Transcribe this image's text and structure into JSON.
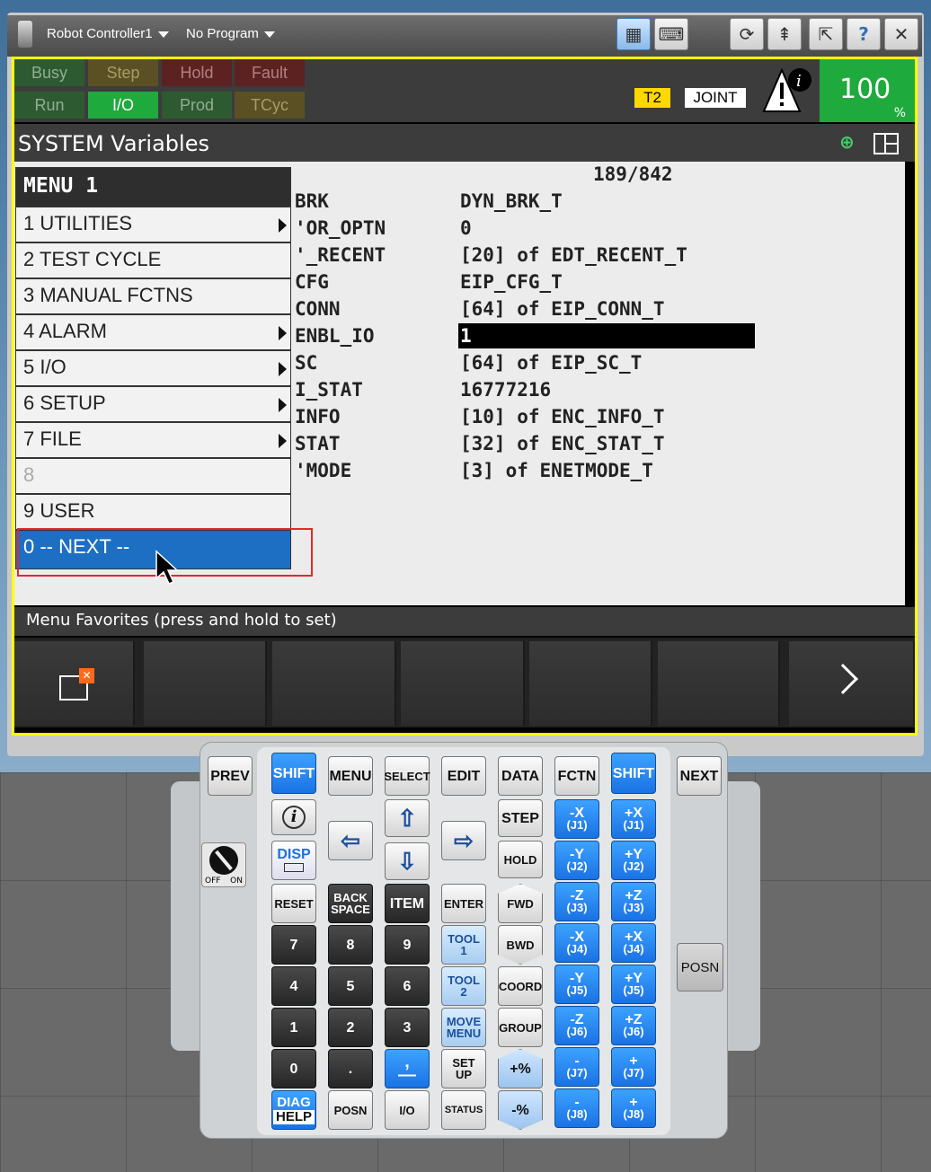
{
  "app": {
    "controller": "Robot Controller1",
    "program": "No Program"
  },
  "status_leds": {
    "row1": [
      "Busy",
      "Step",
      "Hold",
      "Fault"
    ],
    "row2": [
      "Run",
      "I/O",
      "Prod",
      "TCyc"
    ],
    "active": "I/O"
  },
  "indicators": {
    "mode": "T2",
    "coord": "JOINT",
    "override": "100",
    "override_unit": "%"
  },
  "screen": {
    "title": "SYSTEM Variables",
    "position": "189/842"
  },
  "variables": [
    {
      "name": "BRK",
      "value": "DYN_BRK_T"
    },
    {
      "name": "'OR_OPTN",
      "value": "0"
    },
    {
      "name": "'_RECENT",
      "value": "[20] of EDT_RECENT_T"
    },
    {
      "name": "CFG",
      "value": "EIP_CFG_T"
    },
    {
      "name": "CONN",
      "value": "[64] of EIP_CONN_T"
    },
    {
      "name": "ENBL_IO",
      "value": "1"
    },
    {
      "name": "SC",
      "value": "[64] of EIP_SC_T"
    },
    {
      "name": "I_STAT",
      "value": "16777216"
    },
    {
      "name": "INFO",
      "value": "[10] of ENC_INFO_T"
    },
    {
      "name": "STAT",
      "value": "[32] of ENC_STAT_T"
    },
    {
      "name": "'MODE",
      "value": "[3] of ENETMODE_T"
    }
  ],
  "menu": {
    "title": "MENU  1",
    "items": [
      {
        "label": "1 UTILITIES"
      },
      {
        "label": "2 TEST CYCLE"
      },
      {
        "label": "3 MANUAL FCTNS"
      },
      {
        "label": "4 ALARM"
      },
      {
        "label": "5 I/O"
      },
      {
        "label": "6 SETUP"
      },
      {
        "label": "7 FILE"
      },
      {
        "label": "8"
      },
      {
        "label": "9 USER"
      },
      {
        "label": "0 -- NEXT --"
      }
    ]
  },
  "favorites": {
    "label": "Menu Favorites (press and hold to set)"
  },
  "keypad": {
    "top": [
      "PREV",
      "SHIFT",
      "MENU",
      "SELECT",
      "EDIT",
      "DATA",
      "FCTN",
      "SHIFT",
      "NEXT"
    ],
    "disp": "DISP",
    "reset": "RESET",
    "backspace": [
      "BACK",
      "SPACE"
    ],
    "item": "ITEM",
    "enter": "ENTER",
    "step": "STEP",
    "hold": "HOLD",
    "fwd": "FWD",
    "bwd": "BWD",
    "coord": "COORD",
    "group": "GROUP",
    "digits": [
      "7",
      "8",
      "9",
      "4",
      "5",
      "6",
      "1",
      "2",
      "3",
      "0",
      "."
    ],
    "tool1": [
      "TOOL",
      "1"
    ],
    "tool2": [
      "TOOL",
      "2"
    ],
    "move_menu": [
      "MOVE",
      "MENU"
    ],
    "setup": [
      "SET",
      "UP"
    ],
    "plus_pct": "+%",
    "minus_pct": "-%",
    "diag": "DIAG",
    "help": "HELP",
    "posn": "POSN",
    "io": "I/O",
    "status": "STATUS",
    "side_posn": "POSN",
    "switch_off": "OFF",
    "switch_on": "ON",
    "jog": [
      {
        "sign": "-X",
        "axis": "(J1)"
      },
      {
        "sign": "+X",
        "axis": "(J1)"
      },
      {
        "sign": "-Y",
        "axis": "(J2)"
      },
      {
        "sign": "+Y",
        "axis": "(J2)"
      },
      {
        "sign": "-Z",
        "axis": "(J3)"
      },
      {
        "sign": "+Z",
        "axis": "(J3)"
      },
      {
        "sign": "-X",
        "axis": "(J4)"
      },
      {
        "sign": "+X",
        "axis": "(J4)"
      },
      {
        "sign": "-Y",
        "axis": "(J5)"
      },
      {
        "sign": "+Y",
        "axis": "(J5)"
      },
      {
        "sign": "-Z",
        "axis": "(J6)"
      },
      {
        "sign": "+Z",
        "axis": "(J6)"
      },
      {
        "sign": "-",
        "axis": "(J7)"
      },
      {
        "sign": "+",
        "axis": "(J7)"
      },
      {
        "sign": "-",
        "axis": "(J8)"
      },
      {
        "sign": "+",
        "axis": "(J8)"
      }
    ]
  }
}
